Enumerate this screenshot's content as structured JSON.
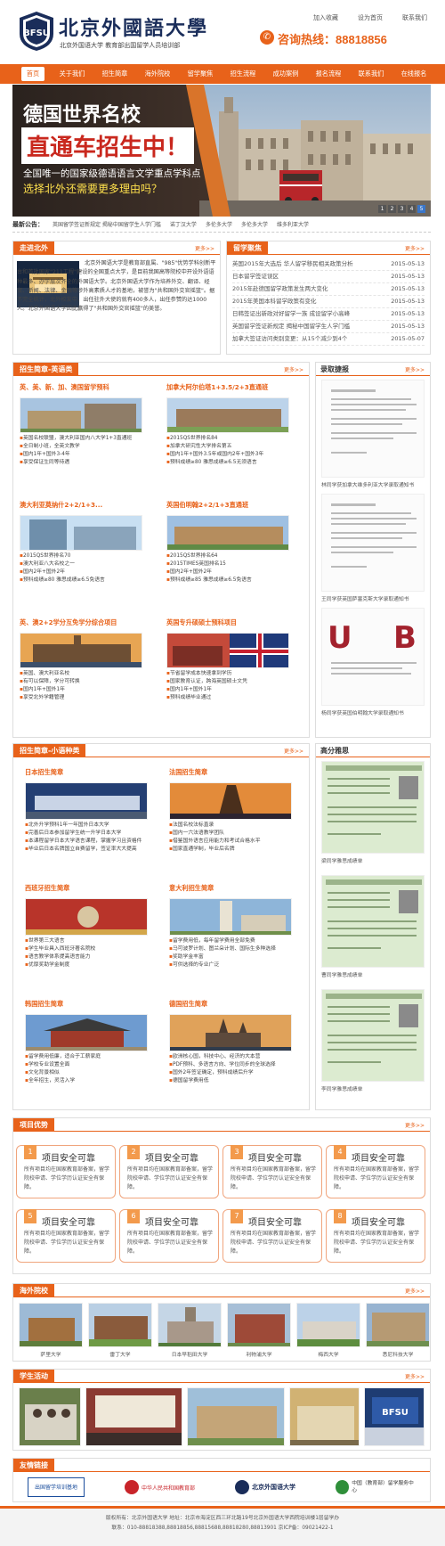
{
  "header": {
    "school_name": "北京外國語大學",
    "subtitle": "北京外国语大学 教育部出国留学人员培训部",
    "top_links": [
      "加入收藏",
      "设为首页",
      "联系我们"
    ],
    "hotline": "咨询热线：88818856"
  },
  "nav": {
    "items": [
      "首页",
      "关于我们",
      "招生简章",
      "海外院校",
      "留学聚焦",
      "招生流程",
      "成功案例",
      "报名流程",
      "联系我们",
      "在线报名"
    ]
  },
  "banner": {
    "line1": "德国世界名校",
    "line2": "直通车招生中！",
    "line3": "全国唯一的国家级德语语言文学重点学科点",
    "line4": "选择北外还需要更多理由吗？",
    "dots": [
      "1",
      "2",
      "3",
      "4",
      "5"
    ]
  },
  "announcement": {
    "label": "最新公告：",
    "items": [
      "英国留学签证新规定 揭秘中国留学生人学门槛",
      "诺丁汉大学",
      "多伦多大学",
      "多伦多大学",
      "维多利亚大学"
    ]
  },
  "intro": {
    "title": "走进北外",
    "more": "更多>>",
    "text": "北京外国语大学是教育部直属、\"985\"优势学科创新平台和首批国家\"211工程\"建设的全国重点大学，是目前我国高等院校中开设外语语种最多、办学层次齐全的外国语大学。北京外国语大学作为培养外交、翻译、经贸、新闻、法律、金融等涉外高素质人才的基地，被誉为\"共和国外交官摇篮\"。据不完全统计，北外校友中，出任驻外大使的就有400多人，出任参赞的达1000人。北京外国语大学因此赢得了\"共和国外交官摇篮\"的美誉。"
  },
  "news": {
    "title": "留学聚焦",
    "more": "更多>>",
    "items": [
      {
        "text": "英国2015年大选后 华人留学移民相关政策分析",
        "date": "2015-05-13"
      },
      {
        "text": "日本留学签证误区",
        "date": "2015-05-13"
      },
      {
        "text": "2015年赴德国留学政策发生两大变化",
        "date": "2015-05-13"
      },
      {
        "text": "2015年美国本科留学政策有变化",
        "date": "2015-05-13"
      },
      {
        "text": "日韩签证出新政对好留学一族 成设留学小高峰",
        "date": "2015-05-13"
      },
      {
        "text": "英国留学签证新规定 揭秘中国留学生人学门槛",
        "date": "2015-05-13"
      },
      {
        "text": "加拿大签证访问类别变更：从15个减少到4个",
        "date": "2015-05-07"
      }
    ]
  },
  "programs_en": {
    "title": "招生简章-英语类",
    "more": "更多>>",
    "items": [
      {
        "title": "英、美、新、加、澳国留学预科",
        "bullets": [
          "英国名校联盟，澳大利亚国内八大学1+3直通班",
          "全日制小班，全英文教学",
          "国内1年+国外3-4年",
          "享受保证生同等待遇"
        ]
      },
      {
        "title": "加拿大阿尔伯塔1+3.5/2+3直通班",
        "bullets": [
          "2015QS世界排名84",
          "加拿大研究性大学排名第五",
          "国内1年+国外3.5年或国内2年+国外3年",
          "预科成绩≥80 雅思成绩≥6.5无须语言"
        ]
      },
      {
        "title": "澳大利亚莫纳什2+2/1+3...",
        "bullets": [
          "2015QS世界排名70",
          "澳大利亚八大名校之一",
          "国内2年+国外2年",
          "预科成绩≥80 雅思成绩≥6.5免语言"
        ]
      },
      {
        "title": "英国伯明翰2+2/1+3直通班",
        "bullets": [
          "2015QS世界排名64",
          "2015TIMES英国排名15",
          "国内2年+国外2年",
          "预科成绩≥85 雅思成绩≥6.5免语言"
        ]
      },
      {
        "title": "英、澳2+2学分互免学分综合项目",
        "bullets": [
          "英国、澳大利亚名校",
          "有可以保障，学分可转换",
          "国内1年+国外1年",
          "享受北外学籍管理"
        ]
      },
      {
        "title": "英国专升硕硕士预科项目",
        "bullets": [
          "节省留学成本快速拿到学历",
          "国家教育认证，跨海英国硕士文凭",
          "国内1年+国外1年",
          "预科成绩毕业通过"
        ]
      }
    ]
  },
  "offers": {
    "title": "录取捷报",
    "more": "更多>>",
    "captions": [
      "林同学获加拿大维多利亚大学录取通知书",
      "王同学获英国萨塞克斯大学录取通知书",
      "杨同学获英国伯明翰大学录取通知书"
    ]
  },
  "programs_small": {
    "title": "招生简章-小语种类",
    "more": "更多>>",
    "items": [
      {
        "title": "日本招生简章",
        "bullets": [
          "北外升学预科1年一年国外日本大学",
          "完善后日本参加留学生统一升学日本大学",
          "本课程留学日本大学语言课程，掌握学习且资格件",
          "毕业后日本名牌国立自费留学，签证率大大提高"
        ]
      },
      {
        "title": "法国招生简章",
        "bullets": [
          "法国名校法标直录",
          "国内一六法语教学团队",
          "借鉴国外语言应用能力和考试合格水平",
          "国家直通学制，毕业后名牌"
        ]
      },
      {
        "title": "西班牙招生简章",
        "bullets": [
          "世界第三大语言",
          "学生毕业具入西班牙著名院校",
          "语言教学体系提高语言能力",
          "优厚奖助学金制度"
        ]
      },
      {
        "title": "意大利招生简章",
        "bullets": [
          "留学费用低，每年留学费用全部免费",
          "马可波罗计划、图兰朵计划、国际生多种选择",
          "奖助学金丰富",
          "可供选择的专业广泛"
        ]
      },
      {
        "title": "韩国招生简章",
        "bullets": [
          "留学费用低廉，适合于工薪家庭",
          "学校专业设置全面",
          "文化背景相似",
          "全年招生，灵活入学"
        ]
      },
      {
        "title": "德国招生简章",
        "bullets": [
          "欧洲核心国，科技中心、经济的大本营",
          "PDF预科、多语言方向、学位同步的全球选择",
          "国外2年签证确定，预科成绩后升学",
          "德国留学费用低"
        ]
      }
    ]
  },
  "scores": {
    "title": "高分雅思",
    "captions": [
      "梁同学雅思成绩单",
      "曹同学雅思成绩单",
      "李同学雅思成绩单"
    ]
  },
  "advantages": {
    "title": "项目优势",
    "more": "更多>>",
    "items": [
      {
        "n": "1",
        "title": "项目安全可靠",
        "desc": "所有项目均在国家教育部备案，留学院校申请、学位学历认证安全有保障。"
      },
      {
        "n": "2",
        "title": "项目安全可靠",
        "desc": "所有项目均在国家教育部备案，留学院校申请、学位学历认证安全有保障。"
      },
      {
        "n": "3",
        "title": "项目安全可靠",
        "desc": "所有项目均在国家教育部备案，留学院校申请、学位学历认证安全有保障。"
      },
      {
        "n": "4",
        "title": "项目安全可靠",
        "desc": "所有项目均在国家教育部备案，留学院校申请、学位学历认证安全有保障。"
      },
      {
        "n": "5",
        "title": "项目安全可靠",
        "desc": "所有项目均在国家教育部备案，留学院校申请、学位学历认证安全有保障。"
      },
      {
        "n": "6",
        "title": "项目安全可靠",
        "desc": "所有项目均在国家教育部备案，留学院校申请、学位学历认证安全有保障。"
      },
      {
        "n": "7",
        "title": "项目安全可靠",
        "desc": "所有项目均在国家教育部备案，留学院校申请、学位学历认证安全有保障。"
      },
      {
        "n": "8",
        "title": "项目安全可靠",
        "desc": "所有项目均在国家教育部备案，留学院校申请、学位学历认证安全有保障。"
      }
    ]
  },
  "schools": {
    "title": "海外院校",
    "more": "更多>>",
    "items": [
      "萨里大学",
      "雷丁大学",
      "日本早稻田大学",
      "利物浦大学",
      "梅西大学",
      "悉尼科技大学"
    ]
  },
  "activities": {
    "title": "学生活动",
    "more": "更多>>"
  },
  "links": {
    "title": "友情链接",
    "items": [
      "出国留学培训基地",
      "中华人民共和国教育部",
      "北京外国语大学",
      "中国（教育部）留学服务中心"
    ]
  },
  "footer": {
    "line1": "版权所有：北京外国语大学 地址：北京市海淀区西三环北路19号北京外国语大学西院培训楼1层留学办",
    "line2": "联系：010-88818388,88818856,88815688,88818280,88813901 京ICP备：09021422-1"
  },
  "colors": {
    "accent": "#e8621a",
    "navy": "#1a2d5a"
  }
}
